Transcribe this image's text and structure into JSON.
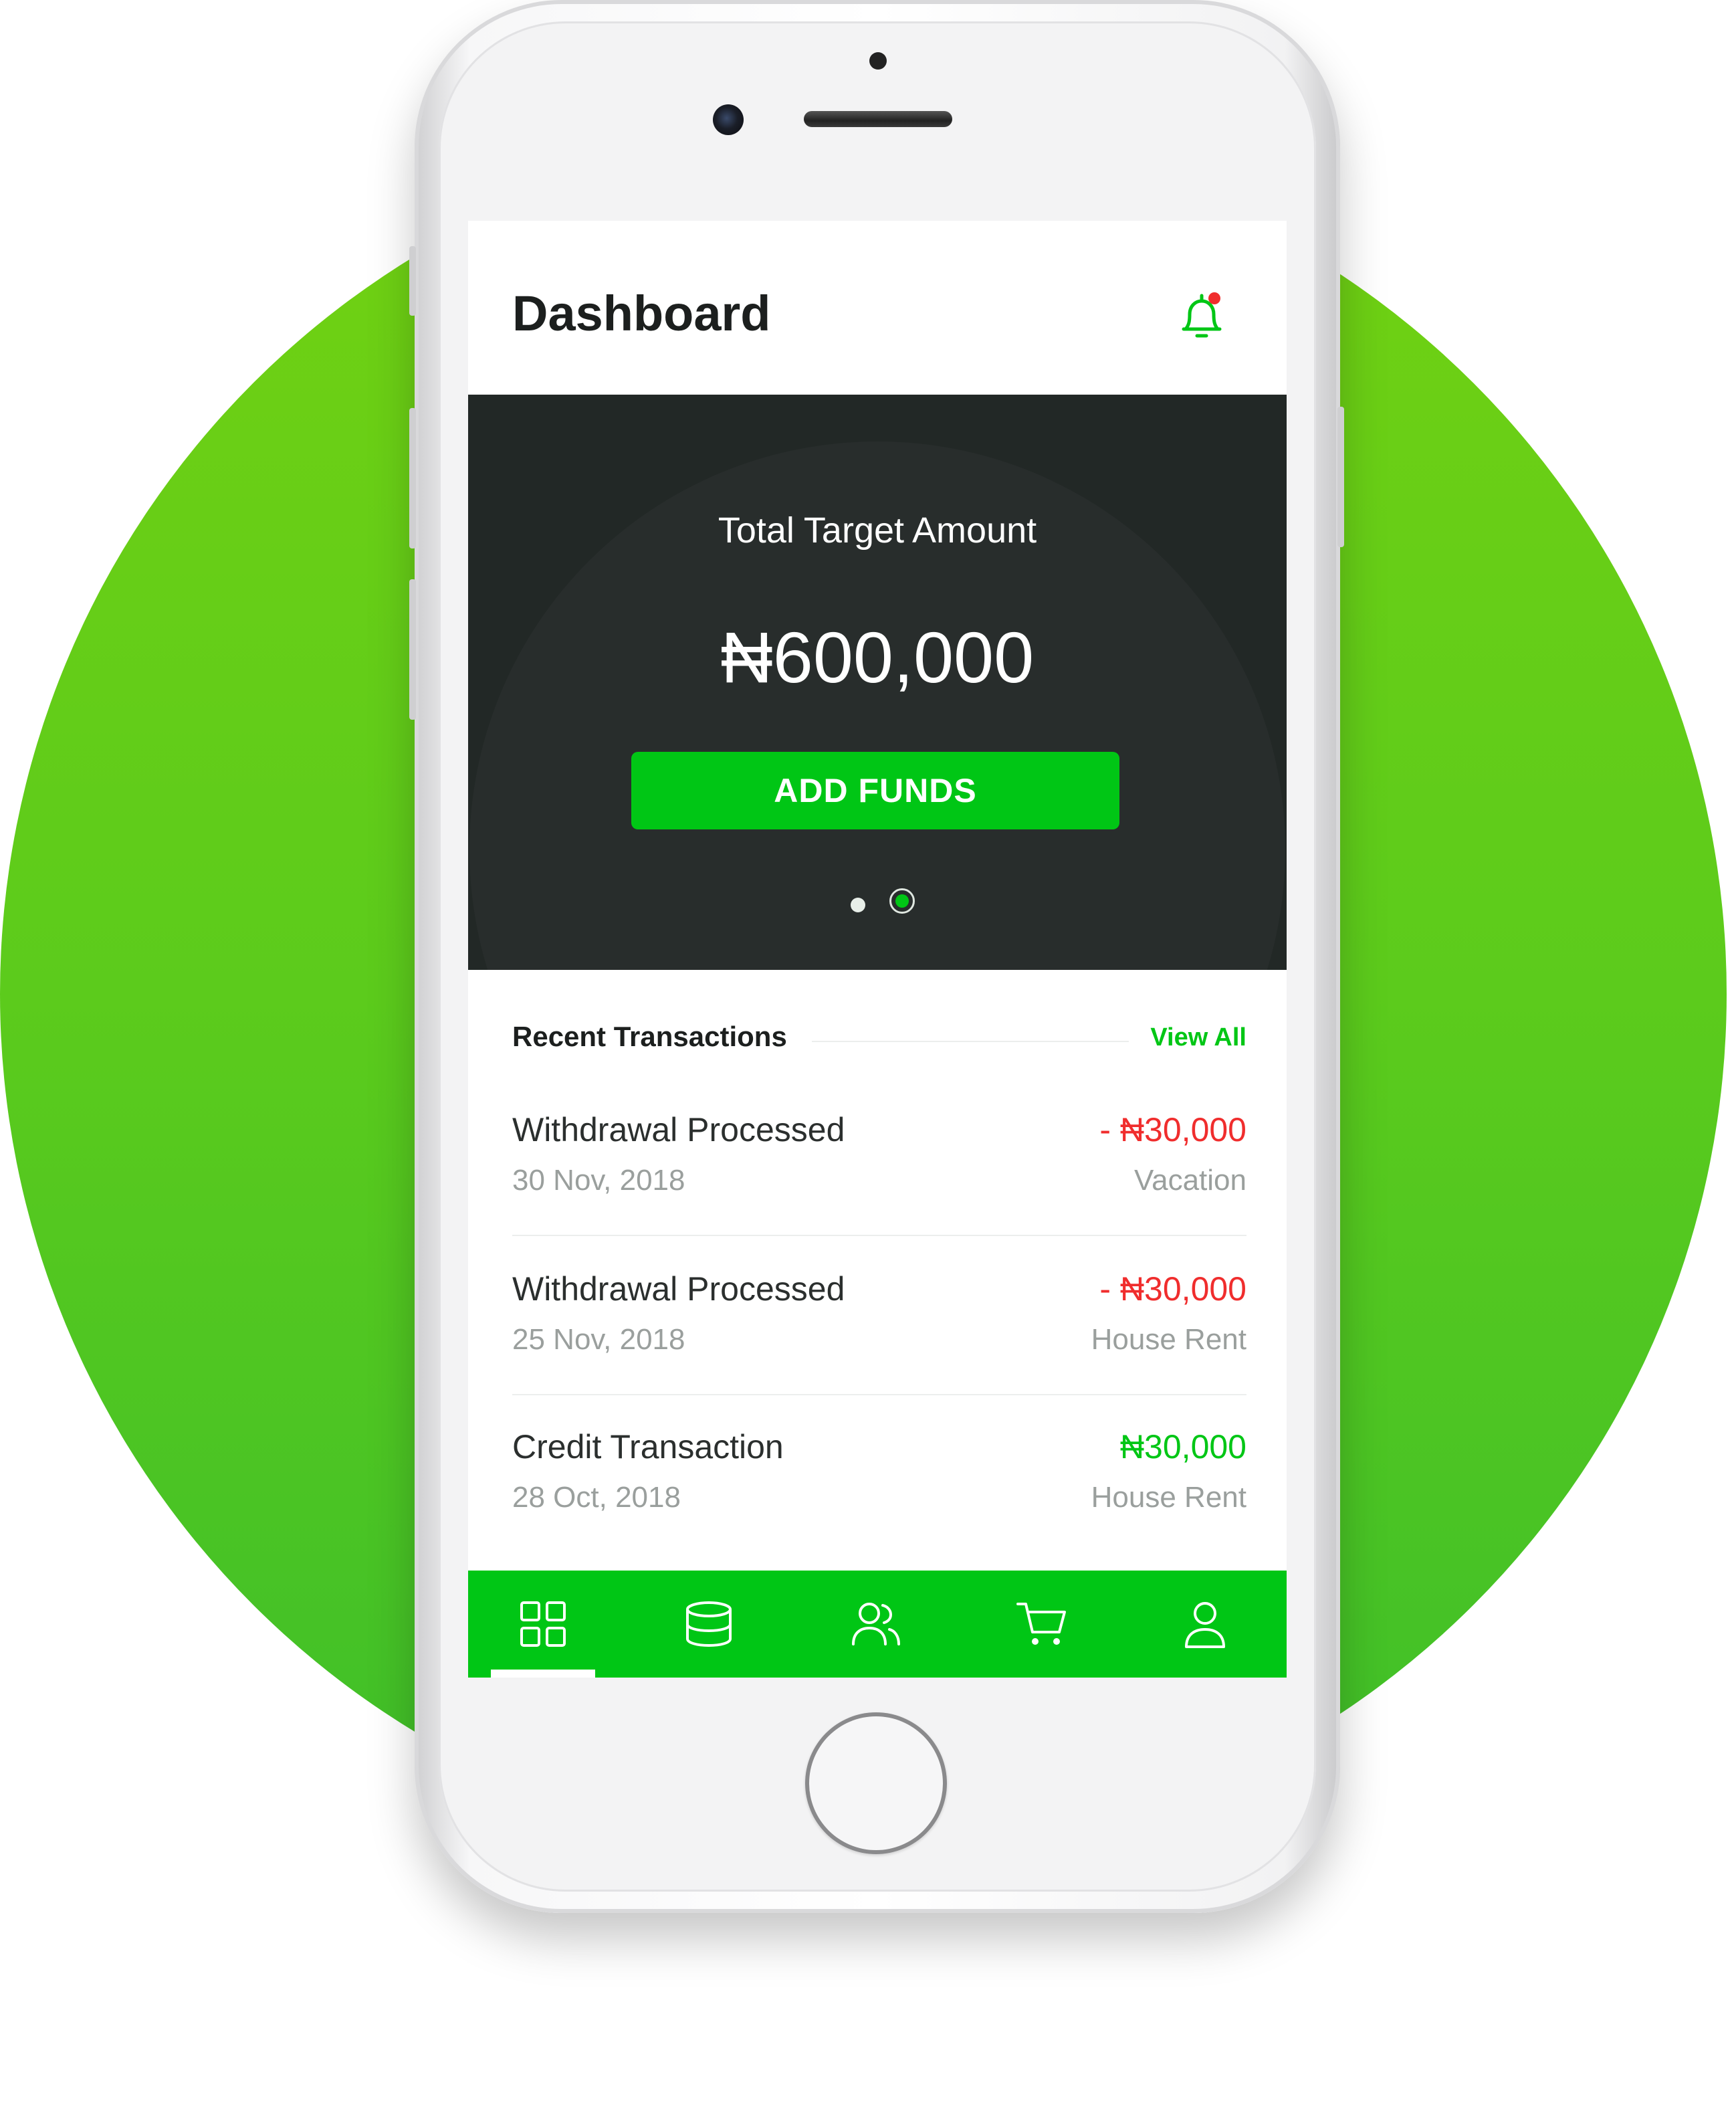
{
  "screen": {
    "title": "Dashboard",
    "notification_icon": "bell-icon"
  },
  "hero": {
    "label": "Total Target Amount",
    "amount": "₦600,000",
    "add_funds_label": "ADD FUNDS",
    "carousel": {
      "pages": 2,
      "active_page": 2
    }
  },
  "transactions": {
    "title": "Recent Transactions",
    "view_all_label": "View All",
    "items": [
      {
        "name": "Withdrawal Processed",
        "date": "30 Nov, 2018",
        "amount": "- ₦30,000",
        "category": "Vacation",
        "type": "debit"
      },
      {
        "name": "Withdrawal Processed",
        "date": "25 Nov, 2018",
        "amount": "- ₦30,000",
        "category": "House Rent",
        "type": "debit"
      },
      {
        "name": "Credit Transaction",
        "date": "28 Oct, 2018",
        "amount": "₦30,000",
        "category": "House Rent",
        "type": "credit"
      }
    ]
  },
  "tabbar": {
    "active": 0,
    "items": [
      {
        "icon": "dashboard-grid-icon"
      },
      {
        "icon": "database-icon"
      },
      {
        "icon": "users-icon"
      },
      {
        "icon": "cart-icon"
      },
      {
        "icon": "user-icon"
      }
    ]
  },
  "colors": {
    "accent_green": "#00c615",
    "debit_red": "#f02d2d",
    "credit_green": "#00c615",
    "hero_dark": "#222826",
    "background_circle": "#5ccb1c"
  }
}
